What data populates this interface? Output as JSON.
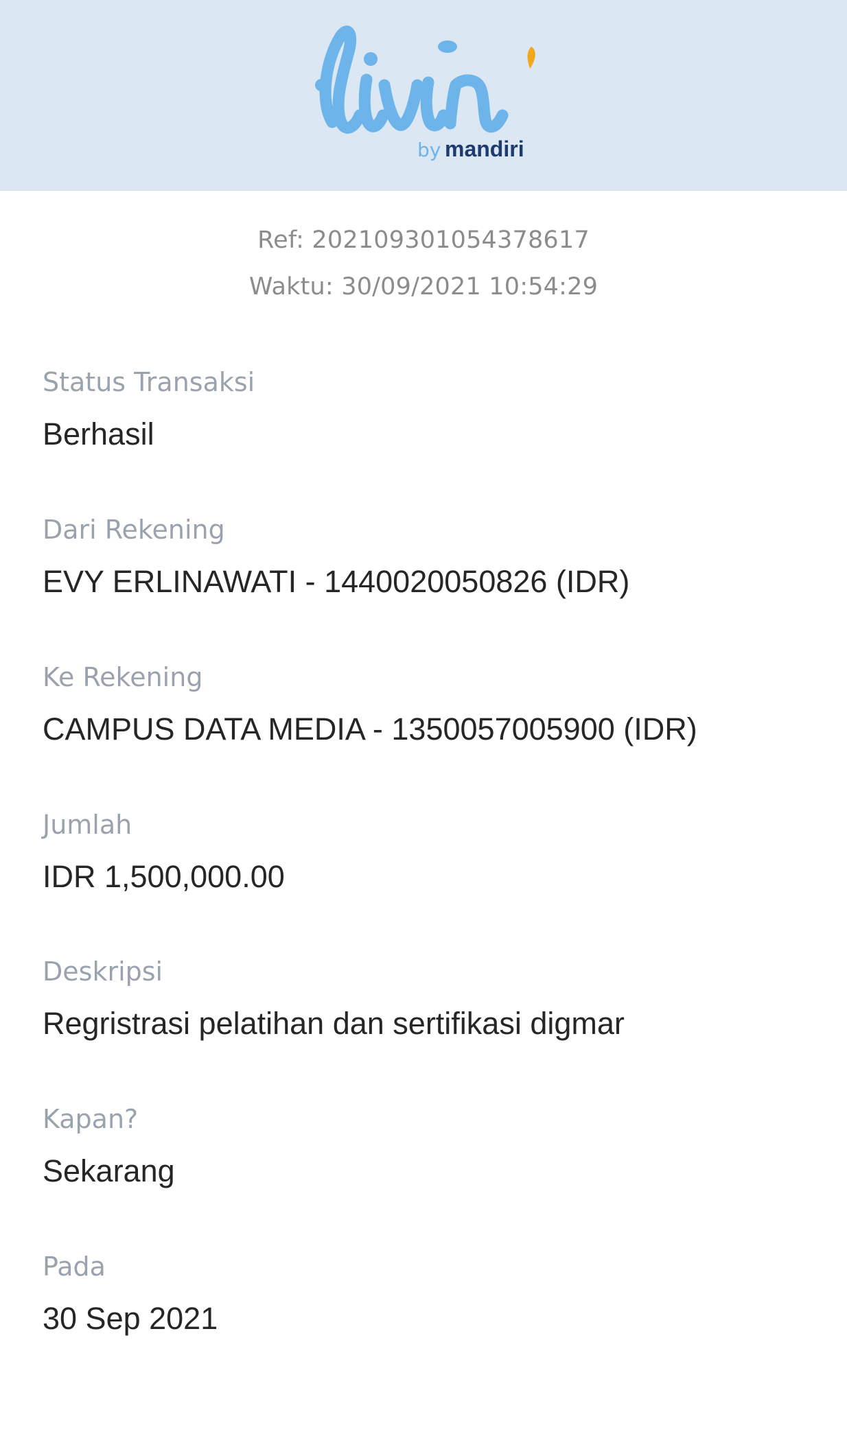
{
  "brand": {
    "logo_wordmark": "livin'",
    "logo_by": "by",
    "logo_bank": "mandiri",
    "colors": {
      "header_bg": "#dbe7f3",
      "logo_blue": "#6cb4ea",
      "logo_accent_yellow": "#f2a81d",
      "bank_navy": "#1d3b6e"
    }
  },
  "receipt": {
    "ref": "Ref: 2021093010543786​17",
    "time": "Waktu: 30/09/2021 10:54:29"
  },
  "fields": [
    {
      "label": "Status Transaksi",
      "value": "Berhasil"
    },
    {
      "label": "Dari Rekening",
      "value": "EVY ERLINAWATI - 1440020050826 (IDR)"
    },
    {
      "label": "Ke Rekening",
      "value": "CAMPUS DATA MEDIA - 1350057005900 (IDR)"
    },
    {
      "label": "Jumlah",
      "value": "IDR 1,500,000.00"
    },
    {
      "label": "Deskripsi",
      "value": "Regristrasi pelatihan dan sertifikasi digmar"
    },
    {
      "label": "Kapan?",
      "value": "Sekarang"
    },
    {
      "label": "Pada",
      "value": "30 Sep 2021"
    }
  ]
}
